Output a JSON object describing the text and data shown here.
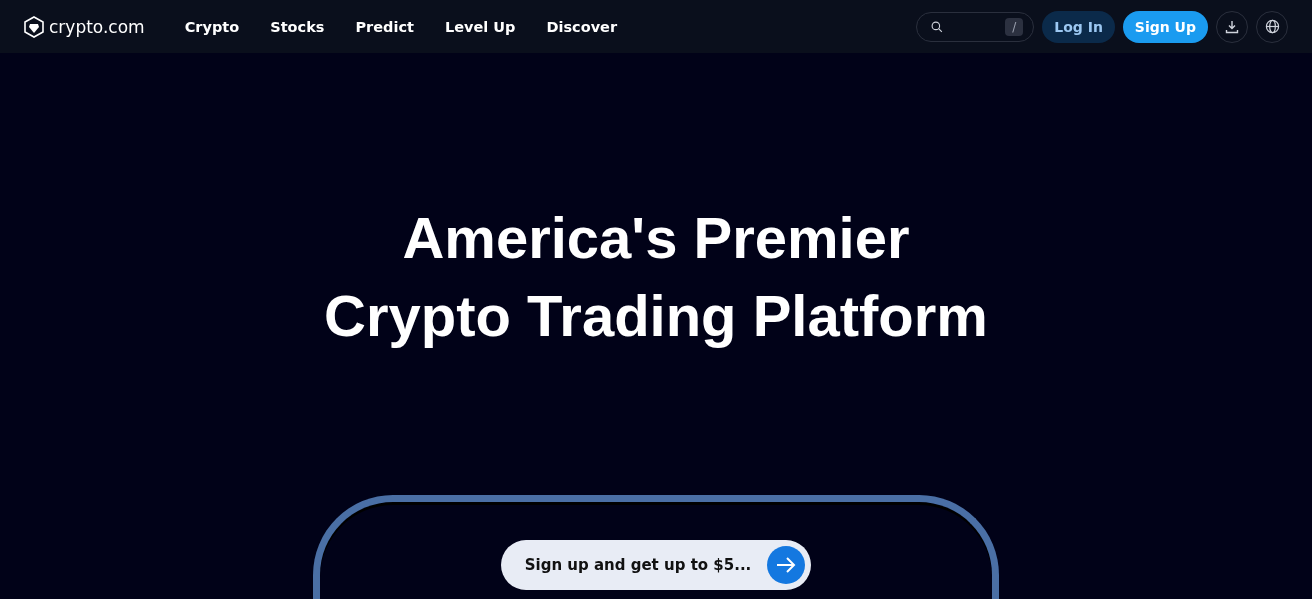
{
  "header": {
    "logo": "crypto.com",
    "nav": [
      {
        "label": "Crypto"
      },
      {
        "label": "Stocks"
      },
      {
        "label": "Predict"
      },
      {
        "label": "Level Up"
      },
      {
        "label": "Discover"
      }
    ],
    "search": {
      "shortcut_key": "/"
    },
    "login": "Log In",
    "signup": "Sign Up"
  },
  "hero": {
    "title_lines": [
      "America's Premier",
      "Crypto Trading Platform"
    ],
    "cta": "Sign up and get up to $5..."
  }
}
